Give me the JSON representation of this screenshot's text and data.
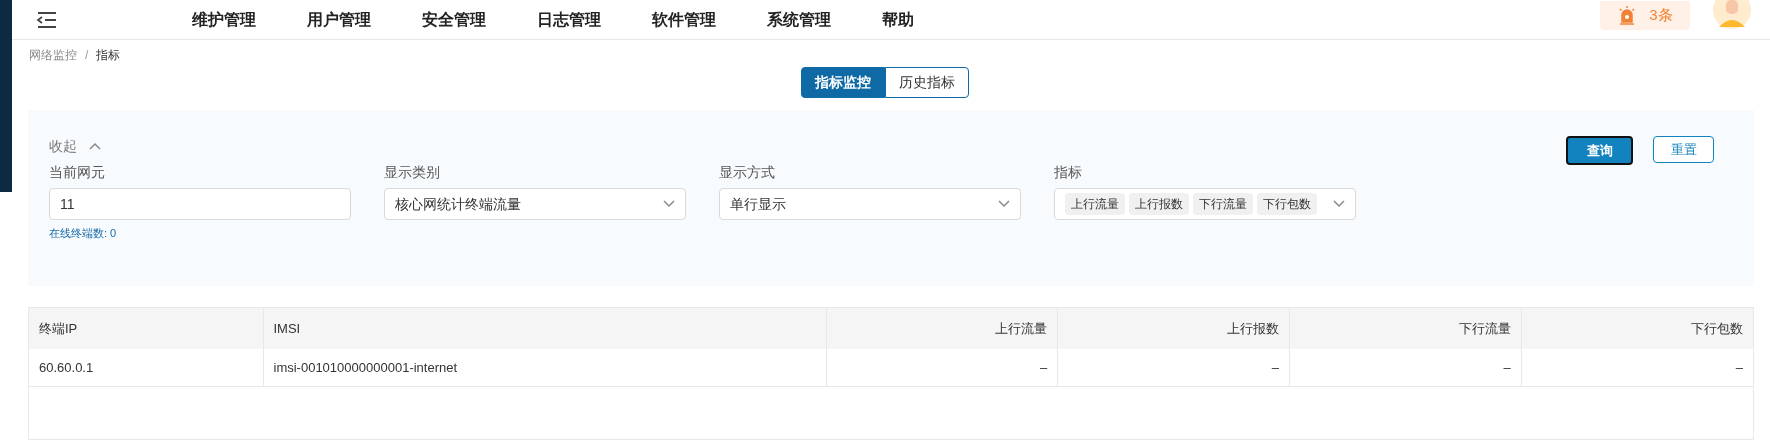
{
  "nav": {
    "menu": [
      "维护管理",
      "用户管理",
      "安全管理",
      "日志管理",
      "软件管理",
      "系统管理",
      "帮助"
    ],
    "alert_count": "3条"
  },
  "breadcrumb": {
    "items": [
      "网络监控",
      "指标"
    ],
    "separator": "/"
  },
  "tabs": [
    {
      "label": "指标监控",
      "selected": true
    },
    {
      "label": "历史指标",
      "selected": false
    }
  ],
  "filter": {
    "collapse": "收起",
    "expanded": true,
    "query": "查询",
    "reset": "重置",
    "fields": [
      {
        "kind": "input",
        "label": "当前网元",
        "value": "11",
        "hint": "在线终端数: 0"
      },
      {
        "kind": "select",
        "label": "显示类别",
        "value": "核心网统计终端流量"
      },
      {
        "kind": "select",
        "label": "显示方式",
        "value": "单行显示"
      },
      {
        "kind": "tags",
        "label": "指标",
        "tags": [
          "上行流量",
          "上行报数",
          "下行流量",
          "下行包数"
        ]
      }
    ]
  },
  "table": {
    "columns": [
      {
        "label": "终端IP",
        "kind": "text"
      },
      {
        "label": "IMSI",
        "kind": "text"
      },
      {
        "label": "上行流量",
        "kind": "number"
      },
      {
        "label": "上行报数",
        "kind": "number"
      },
      {
        "label": "下行流量",
        "kind": "number"
      },
      {
        "label": "下行包数",
        "kind": "number"
      }
    ],
    "rows": [
      [
        "60.60.0.1",
        "imsi-001010000000001-internet",
        "–",
        "–",
        "–",
        "–"
      ]
    ]
  }
}
